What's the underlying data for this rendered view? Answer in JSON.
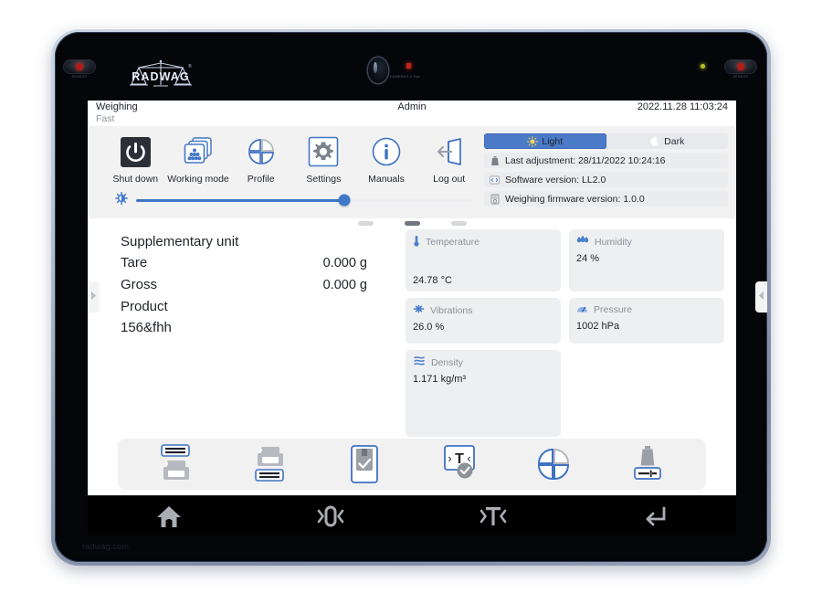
{
  "device": {
    "brand": "RADWAG",
    "footer_url": "radwag.com",
    "sensor_label_left": "SENSOR",
    "sensor_label_right": "SENSOR",
    "camera_label": "CAMERA 5.0 Mpx"
  },
  "status_bar": {
    "mode": "Weighing",
    "submode": "Fast",
    "user": "Admin",
    "datetime": "2022.11.28 11:03:24"
  },
  "shortcuts": [
    {
      "label": "Shut down",
      "icon": "power-icon"
    },
    {
      "label": "Working mode",
      "icon": "working-mode-icon"
    },
    {
      "label": "Profile",
      "icon": "profile-icon"
    },
    {
      "label": "Settings",
      "icon": "gear-icon"
    },
    {
      "label": "Manuals",
      "icon": "info-icon"
    },
    {
      "label": "Log out",
      "icon": "logout-icon"
    }
  ],
  "brightness": {
    "icon": "brightness-icon",
    "value_percent": 62
  },
  "theme": {
    "selected": "Light",
    "options": [
      {
        "label": "Light",
        "icon": "sun-icon"
      },
      {
        "label": "Dark",
        "icon": "moon-icon"
      }
    ],
    "accent_hex": "#4b7ac8"
  },
  "info_rows": [
    {
      "icon": "weight-icon",
      "text": "Last adjustment: 28/11/2022 10:24:16"
    },
    {
      "icon": "software-icon",
      "text": "Software version: LL2.0"
    },
    {
      "icon": "balance-icon",
      "text": "Weighing firmware version: 1.0.0"
    }
  ],
  "pager": {
    "count": 3,
    "active_index": 1
  },
  "readout": {
    "lines": [
      {
        "label": "Supplementary unit",
        "value": ""
      },
      {
        "label": "Tare",
        "value": "0.000 g"
      },
      {
        "label": "Gross",
        "value": "0.000 g"
      },
      {
        "label": "Product",
        "value": ""
      },
      {
        "label": "156&fhh",
        "value": ""
      }
    ]
  },
  "sensors": [
    {
      "name": "Temperature",
      "value": "24.78 °C",
      "icon": "thermometer-icon"
    },
    {
      "name": "Humidity",
      "value": "24 %",
      "icon": "humidity-icon"
    },
    {
      "name": "Pressure",
      "value": "1002 hPa",
      "icon": "pressure-icon"
    },
    {
      "name": "Vibrations",
      "value": "26.0 %",
      "icon": "vibrations-icon"
    },
    {
      "name": "Density",
      "value": "1.171 kg/m³",
      "icon": "density-icon"
    }
  ],
  "function_bar": [
    {
      "name": "print-header",
      "icon": "print-header-icon"
    },
    {
      "name": "print-footer",
      "icon": "print-footer-icon"
    },
    {
      "name": "save-measurement",
      "icon": "save-check-icon"
    },
    {
      "name": "tare-confirm",
      "icon": "tare-check-icon"
    },
    {
      "name": "profile-select",
      "icon": "profile-icon"
    },
    {
      "name": "calibration-weight",
      "icon": "weight-adjust-icon"
    }
  ],
  "nav_bar": [
    {
      "name": "home",
      "icon": "home-icon"
    },
    {
      "name": "zero",
      "icon": "zero-icon",
      "glyph": "›O‹"
    },
    {
      "name": "tare",
      "icon": "tare-icon",
      "glyph": "›T‹"
    },
    {
      "name": "enter",
      "icon": "enter-icon",
      "glyph": "↵"
    }
  ],
  "side_handles": [
    {
      "name": "left-panel-handle",
      "icon": "chevron-right-icon"
    },
    {
      "name": "right-panel-handle",
      "icon": "chevron-left-icon"
    }
  ]
}
